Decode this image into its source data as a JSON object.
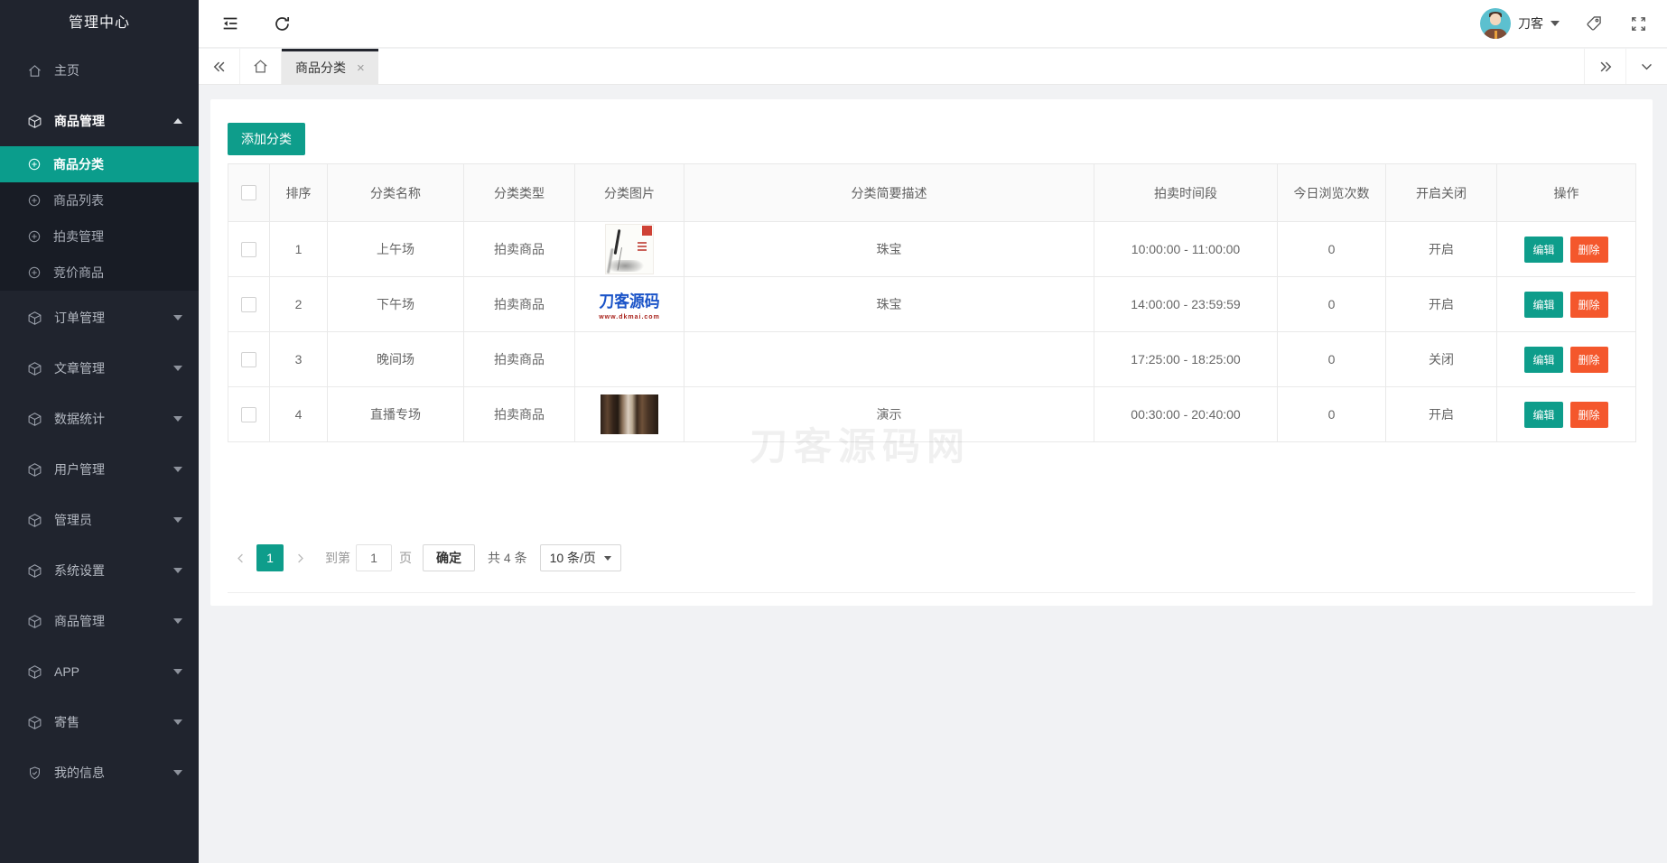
{
  "colors": {
    "accent": "#0e9d8b",
    "danger": "#f4572c",
    "sidebar_bg": "#20242e",
    "submenu_bg": "#181c25",
    "active_tab_bg": "#e9e9e9"
  },
  "app": {
    "title": "管理中心"
  },
  "header": {
    "user_name": "刀客"
  },
  "tab_bar": {
    "active_tab": "商品分类"
  },
  "sidebar": {
    "items": [
      {
        "label": "主页",
        "icon": "home"
      },
      {
        "label": "商品管理",
        "icon": "cube",
        "state": "expanded-active"
      },
      {
        "label": "商品分类",
        "icon": "circle-plus",
        "sub": true,
        "active": true
      },
      {
        "label": "商品列表",
        "icon": "circle-plus",
        "sub": true
      },
      {
        "label": "拍卖管理",
        "icon": "circle-plus",
        "sub": true
      },
      {
        "label": "竞价商品",
        "icon": "circle-plus",
        "sub": true
      },
      {
        "label": "订单管理",
        "icon": "cube"
      },
      {
        "label": "文章管理",
        "icon": "cube"
      },
      {
        "label": "数据统计",
        "icon": "cube"
      },
      {
        "label": "用户管理",
        "icon": "cube"
      },
      {
        "label": "管理员",
        "icon": "cube"
      },
      {
        "label": "系统设置",
        "icon": "cube"
      },
      {
        "label": "商品管理",
        "icon": "cube"
      },
      {
        "label": "APP",
        "icon": "cube"
      },
      {
        "label": "寄售",
        "icon": "cube"
      },
      {
        "label": "我的信息",
        "icon": "shield-check"
      }
    ]
  },
  "toolbar": {
    "add_button": "添加分类"
  },
  "table": {
    "columns": {
      "order": "排序",
      "name": "分类名称",
      "type": "分类类型",
      "image": "分类图片",
      "desc": "分类简要描述",
      "time": "拍卖时间段",
      "views": "今日浏览次数",
      "status": "开启关闭",
      "action": "操作"
    },
    "rows": [
      {
        "order": "1",
        "name": "上午场",
        "type": "拍卖商品",
        "image": "ink-painting",
        "desc": "珠宝",
        "time": "10:00:00  -  11:00:00",
        "views": "0",
        "status": "开启"
      },
      {
        "order": "2",
        "name": "下午场",
        "type": "拍卖商品",
        "image": "daoke-logo",
        "desc": "珠宝",
        "time": "14:00:00  -  23:59:59",
        "views": "0",
        "status": "开启"
      },
      {
        "order": "3",
        "name": "晚间场",
        "type": "拍卖商品",
        "image": "",
        "desc": "",
        "time": "17:25:00  -  18:25:00",
        "views": "0",
        "status": "关闭"
      },
      {
        "order": "4",
        "name": "直播专场",
        "type": "拍卖商品",
        "image": "photo",
        "desc": "演示",
        "time": "00:30:00  -  20:40:00",
        "views": "0",
        "status": "开启"
      }
    ],
    "actions": {
      "edit": "编辑",
      "delete": "删除"
    }
  },
  "images": {
    "logo_text": "刀客源码",
    "logo_url": "www.dkmai.com"
  },
  "pagination": {
    "current_page": "1",
    "goto_label": "到第",
    "goto_value": "1",
    "page_label": "页",
    "confirm_label": "确定",
    "total_label": "共 4 条",
    "per_page_label": "10 条/页"
  },
  "watermark": "刀客源码网"
}
